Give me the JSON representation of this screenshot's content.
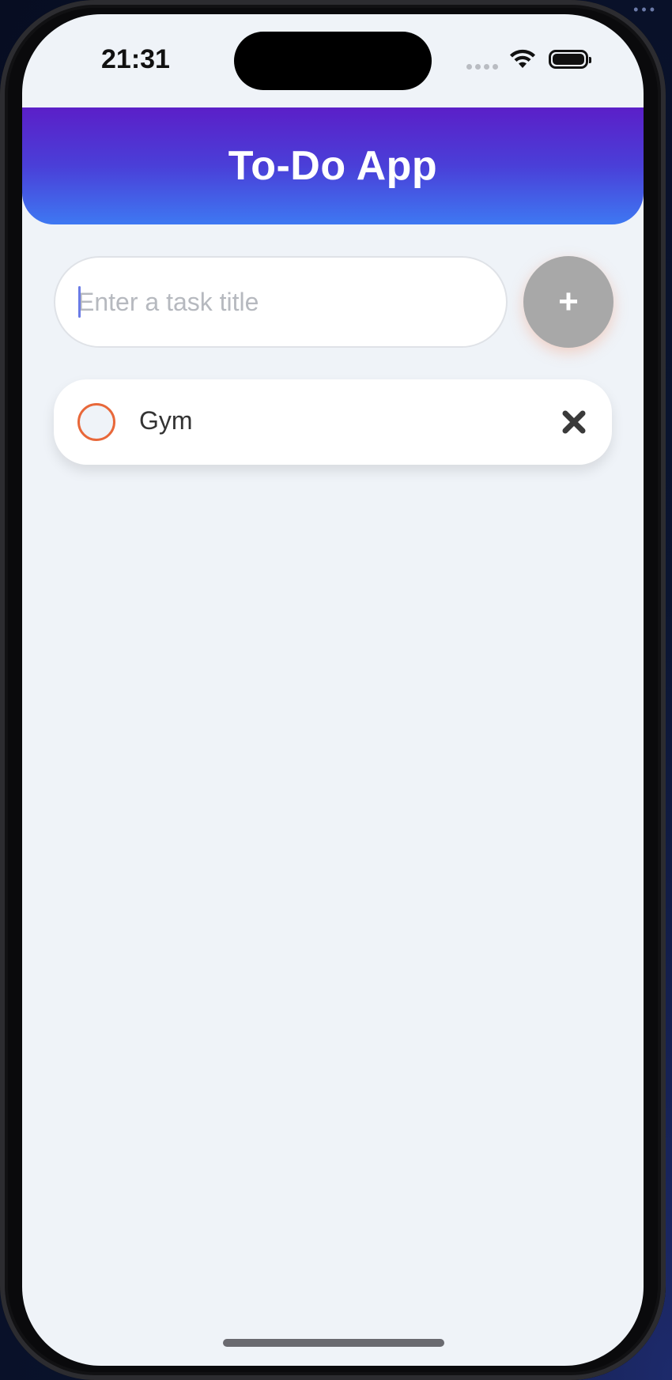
{
  "status_bar": {
    "time": "21:31",
    "icons": [
      "cellular-signal-icon",
      "wifi-icon",
      "battery-icon"
    ]
  },
  "header": {
    "title": "To-Do App",
    "gradient_top": "#5b1fc8",
    "gradient_bottom": "#3e78f2"
  },
  "input": {
    "placeholder": "Enter a task title",
    "value": ""
  },
  "add_button": {
    "label": "+",
    "color": "#a8a8a8"
  },
  "tasks": [
    {
      "title": "Gym",
      "completed": false,
      "check_color": "#e8683a",
      "delete_icon": "close-icon"
    }
  ]
}
